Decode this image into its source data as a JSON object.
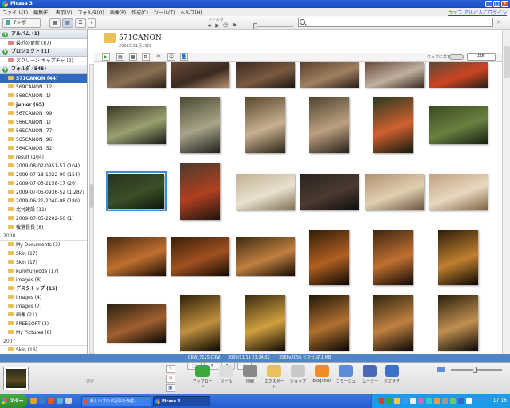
{
  "window": {
    "title": "Picasa 3",
    "minimize": "_",
    "maximize": "□",
    "close": "×"
  },
  "menu": {
    "items": [
      "ファイル(F)",
      "編集(E)",
      "表示(V)",
      "フォルダ(O)",
      "画像(P)",
      "作成(C)",
      "ツール(T)",
      "ヘルプ(H)"
    ],
    "web_link": "ウェブ アルバムにログイン"
  },
  "toolbar": {
    "import_label": "インポート",
    "filter_label": "フィルタ",
    "filter_icons": [
      "★",
      "▶",
      "☺",
      "⚑"
    ],
    "search_placeholder": "",
    "search_clear": "×"
  },
  "sidebar": {
    "sections": [
      {
        "label": "アルバム (1)",
        "toggle": "▼",
        "items": [
          {
            "label": "最近の更新 (87)"
          }
        ]
      },
      {
        "label": "プロジェクト (1)",
        "toggle": "▼",
        "items": [
          {
            "label": "スクリーン キャプチャ (2)"
          }
        ]
      },
      {
        "label": "フォルダ (545)",
        "toggle": "▼",
        "items": []
      }
    ],
    "folders_2009": [
      {
        "label": "571CANON (44)",
        "selected": true,
        "bold": true
      },
      {
        "label": "569CANON (12)"
      },
      {
        "label": "568CANON (1)"
      },
      {
        "label": "junior (65)",
        "bold": true
      },
      {
        "label": "567CANON (99)"
      },
      {
        "label": "566CANON (1)"
      },
      {
        "label": "565CANON (77)"
      },
      {
        "label": "565CANON (96)"
      },
      {
        "label": "564CANON (52)"
      },
      {
        "label": "result (104)"
      },
      {
        "label": "2009-08-02-0951-57 (104)"
      },
      {
        "label": "2009-07-18-1022-00 (154)"
      },
      {
        "label": "2009-07-05-2158-17 (26)"
      },
      {
        "label": "2009-07-05-0936-52 (1,287)"
      },
      {
        "label": "2009-06-21-2040-08 (180)"
      },
      {
        "label": "北村建設 (11)"
      },
      {
        "label": "2009-07-05-2202-50 (1)"
      },
      {
        "label": "複選長長 (8)"
      }
    ],
    "year_2008": "2008",
    "folders_2008": [
      {
        "label": "My Documents (3)"
      },
      {
        "label": "Skin (17)"
      },
      {
        "label": "Skin (17)"
      },
      {
        "label": "kurohuneode (17)"
      },
      {
        "label": "images (8)"
      },
      {
        "label": "デスクトップ (15)",
        "bold": true
      },
      {
        "label": "images (4)"
      },
      {
        "label": "images (7)"
      },
      {
        "label": "画像 (21)"
      },
      {
        "label": "FREESOFT (3)"
      },
      {
        "label": "My Pictures (8)"
      }
    ],
    "year_2007": "2007",
    "folders_2007": [
      {
        "label": "Skin (16)"
      }
    ]
  },
  "folder_header": {
    "name": "571CANON",
    "date": "2009年11月15日",
    "action_icons": [
      "▶",
      "▤",
      "▦",
      "⊞",
      "✂",
      "☺",
      "👤"
    ],
    "web_share_label": "ウェブに共有",
    "share_button": "共有"
  },
  "thumbnails": [
    {
      "c1": "#4a3a2a",
      "c2": "#8b6f55",
      "c3": "#2b2018"
    },
    {
      "c1": "#6b4a3a",
      "c2": "#3a2a20",
      "c3": "#b89070"
    },
    {
      "c1": "#3a2a22",
      "c2": "#7a5a40",
      "c3": "#1f1612"
    },
    {
      "c1": "#5a4030",
      "c2": "#a08060",
      "c3": "#2a1e16"
    },
    {
      "c1": "#6a4a3a",
      "c2": "#c0b0a0",
      "c3": "#3a2a20"
    },
    {
      "c1": "#5b4a3a",
      "c2": "#cc4422",
      "c3": "#2a2018"
    },
    {
      "c1": "#3a3526",
      "c2": "#9aa070",
      "c3": "#1a1a14"
    },
    {
      "c1": "#4a4a30",
      "c2": "#a8a48a",
      "c3": "#20201a"
    },
    {
      "c1": "#5a4a30",
      "c2": "#c8b090",
      "c3": "#2a2418"
    },
    {
      "c1": "#504530",
      "c2": "#bca080",
      "c3": "#26201a"
    },
    {
      "c1": "#2a3a20",
      "c2": "#d06030",
      "c3": "#101a0c"
    },
    {
      "c1": "#3a4a20",
      "c2": "#6a8040",
      "c3": "#142010"
    },
    {
      "c1": "#2a3020",
      "c2": "#3a5028",
      "c3": "#0e140a"
    },
    {
      "c1": "#4a3a2a",
      "c2": "#b04020",
      "c3": "#1c1410"
    },
    {
      "c1": "#c0b090",
      "c2": "#e8e0d0",
      "c3": "#807050"
    },
    {
      "c1": "#2a2420",
      "c2": "#4a3a30",
      "c3": "#0e0c0a"
    },
    {
      "c1": "#b09070",
      "c2": "#e0d0b0",
      "c3": "#6a5040"
    },
    {
      "c1": "#c0a080",
      "c2": "#e8d8c0",
      "c3": "#806040"
    },
    {
      "c1": "#4a2a10",
      "c2": "#c07030",
      "c3": "#1a0c04"
    },
    {
      "c1": "#3a2008",
      "c2": "#a05020",
      "c3": "#120a02"
    },
    {
      "c1": "#402a10",
      "c2": "#c08040",
      "c3": "#160c04"
    },
    {
      "c1": "#301c08",
      "c2": "#b06020",
      "c3": "#0c0602"
    },
    {
      "c1": "#3a2410",
      "c2": "#c07030",
      "c3": "#100804"
    },
    {
      "c1": "#2a1a08",
      "c2": "#c08030",
      "c3": "#0a0602"
    },
    {
      "c1": "#2a2010",
      "c2": "#a06030",
      "c3": "#0a0804"
    },
    {
      "c1": "#302008",
      "c2": "#c09040",
      "c3": "#0c0802"
    },
    {
      "c1": "#3a2a10",
      "c2": "#d0a040",
      "c3": "#100a04"
    },
    {
      "c1": "#201808",
      "c2": "#b07030",
      "c3": "#080602"
    },
    {
      "c1": "#302410",
      "c2": "#c08040",
      "c3": "#0c0804"
    },
    {
      "c1": "#2a1e0c",
      "c2": "#c09050",
      "c3": "#0a0804"
    }
  ],
  "status_strip": {
    "filename": "CRW_7125.CRW",
    "datetime": "2009/11/15 23:24:32",
    "dimensions": "3568x2056 ピクセル",
    "filesize": "7.1 MB"
  },
  "tray": {
    "held_label": "選択",
    "side_icons": [
      "✎",
      "⊘",
      "▣"
    ],
    "rotate_icons": [
      "⬚",
      "↺",
      "↻",
      "★"
    ],
    "tools": [
      {
        "label": "アップロード",
        "color": "#3aaa3a"
      },
      {
        "label": "メール",
        "color": "#dddddd"
      },
      {
        "label": "印刷",
        "color": "#888888"
      },
      {
        "label": "エクスポート",
        "color": "#e8c15a"
      },
      {
        "label": "ショップ",
        "color": "#c8c8c8"
      },
      {
        "label": "BlogThis!",
        "color": "#f08a2a"
      },
      {
        "label": "コラージュ",
        "color": "#5a8ad8"
      },
      {
        "label": "ムービー",
        "color": "#4a6ab8"
      },
      {
        "label": "ジオタグ",
        "color": "#3a70c8"
      }
    ]
  },
  "taskbar": {
    "start_label": "スタート",
    "tasks": [
      "新しいブログ記事を作成 -...",
      "Picasa 3"
    ],
    "clock": "17:16"
  },
  "colors": {
    "accent": "#3168c0",
    "title_bar": "#2a63d6",
    "status_strip": "#4f85c8"
  }
}
